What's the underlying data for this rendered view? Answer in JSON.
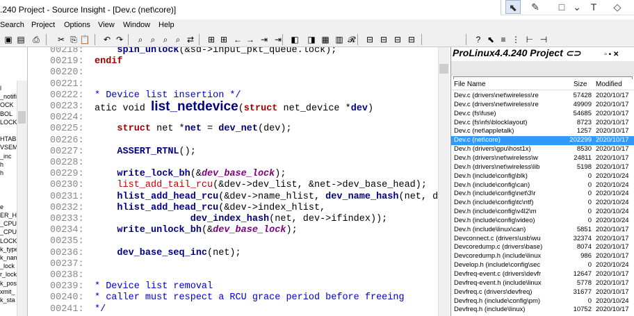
{
  "window": {
    "title": ".240 Project - Source Insight - [Dev.c (net\\core)]"
  },
  "annotation_tools": [
    {
      "name": "pointer-icon",
      "glyph": "⬉",
      "selected": true
    },
    {
      "name": "pen-icon",
      "glyph": "✎",
      "selected": false
    },
    {
      "name": "rectangle-icon",
      "glyph": "□",
      "selected": false
    },
    {
      "name": "dropdown-icon",
      "glyph": "⌄",
      "selected": false
    },
    {
      "name": "text-icon",
      "glyph": "T",
      "selected": false
    },
    {
      "name": "eraser-icon",
      "glyph": "◇",
      "selected": false
    }
  ],
  "menu": [
    "Search",
    "Project",
    "Options",
    "View",
    "Window",
    "Help"
  ],
  "left_symbols": [
    "l",
    "_notifi",
    "OCK",
    "BOL",
    "LOCK",
    "",
    "HTABI",
    "VSEM",
    "_inc",
    "h",
    "h",
    "",
    "",
    "",
    "e",
    "ER_HI",
    "_CPU_",
    "_CPU",
    "LOCK",
    "k_type",
    "k_nam",
    "_lock",
    "r_lock",
    "k_pos",
    "xmit_",
    "k_sta"
  ],
  "editor": {
    "lines": [
      {
        "n": "00218:",
        "parts": [
          {
            "c": "fn",
            "t": "    spin_unlock"
          },
          {
            "c": "pl",
            "t": "(&sd->input_pkt_queue.lock);"
          }
        ]
      },
      {
        "n": "00219:",
        "parts": [
          {
            "c": "kw",
            "t": "endif"
          }
        ]
      },
      {
        "n": "00220:",
        "parts": []
      },
      {
        "n": "00221:",
        "parts": []
      },
      {
        "n": "00222:",
        "parts": [
          {
            "c": "cm",
            "t": "* Device list insertion */"
          }
        ]
      },
      {
        "n": "00223:",
        "parts": [
          {
            "c": "pl",
            "t": "atic void "
          },
          {
            "c": "fnbig",
            "t": "list_netdevice"
          },
          {
            "c": "pl",
            "t": "("
          },
          {
            "c": "kw",
            "t": "struct"
          },
          {
            "c": "pl",
            "t": " net_device *"
          },
          {
            "c": "fn",
            "t": "dev"
          },
          {
            "c": "pl",
            "t": ")"
          }
        ]
      },
      {
        "n": "00224:",
        "parts": []
      },
      {
        "n": "00225:",
        "parts": [
          {
            "c": "kw",
            "t": "    struct"
          },
          {
            "c": "pl",
            "t": " net *"
          },
          {
            "c": "fn",
            "t": "net"
          },
          {
            "c": "pl",
            "t": " = "
          },
          {
            "c": "fn",
            "t": "dev_net"
          },
          {
            "c": "pl",
            "t": "(dev);"
          }
        ]
      },
      {
        "n": "00226:",
        "parts": []
      },
      {
        "n": "00227:",
        "parts": [
          {
            "c": "fn",
            "t": "    ASSERT_RTNL"
          },
          {
            "c": "pl",
            "t": "();"
          }
        ]
      },
      {
        "n": "00228:",
        "parts": []
      },
      {
        "n": "00229:",
        "parts": [
          {
            "c": "fn",
            "t": "    write_lock_bh"
          },
          {
            "c": "pl",
            "t": "(&"
          },
          {
            "c": "it",
            "t": "dev_base_lock"
          },
          {
            "c": "pl",
            "t": ");"
          }
        ]
      },
      {
        "n": "00230:",
        "parts": [
          {
            "c": "rd",
            "t": "    list_add_tail_rcu"
          },
          {
            "c": "pl",
            "t": "(&dev->dev_list, &net->dev_base_head);"
          }
        ]
      },
      {
        "n": "00231:",
        "parts": [
          {
            "c": "fn",
            "t": "    hlist_add_head_rcu"
          },
          {
            "c": "pl",
            "t": "(&dev->name_hlist, "
          },
          {
            "c": "fn",
            "t": "dev_name_hash"
          },
          {
            "c": "pl",
            "t": "(net, de"
          }
        ]
      },
      {
        "n": "00232:",
        "parts": [
          {
            "c": "fn",
            "t": "    hlist_add_head_rcu"
          },
          {
            "c": "pl",
            "t": "(&dev->index_hlist,"
          }
        ]
      },
      {
        "n": "00233:",
        "parts": [
          {
            "c": "fn",
            "t": "                 dev_index_hash"
          },
          {
            "c": "pl",
            "t": "(net, dev->ifindex));"
          }
        ]
      },
      {
        "n": "00234:",
        "parts": [
          {
            "c": "fn",
            "t": "    write_unlock_bh"
          },
          {
            "c": "pl",
            "t": "(&"
          },
          {
            "c": "it",
            "t": "dev_base_lock"
          },
          {
            "c": "pl",
            "t": ");"
          }
        ]
      },
      {
        "n": "00235:",
        "parts": []
      },
      {
        "n": "00236:",
        "parts": [
          {
            "c": "fn",
            "t": "    dev_base_seq_inc"
          },
          {
            "c": "pl",
            "t": "(net);"
          }
        ]
      },
      {
        "n": "00237:",
        "parts": []
      },
      {
        "n": "00238:",
        "parts": []
      },
      {
        "n": "00239:",
        "parts": [
          {
            "c": "cm",
            "t": "* Device list removal"
          }
        ]
      },
      {
        "n": "00240:",
        "parts": [
          {
            "c": "cm",
            "t": "* caller must respect a RCU grace period before freeing"
          }
        ]
      },
      {
        "n": "00241:",
        "parts": [
          {
            "c": "cm",
            "t": "*/"
          }
        ]
      }
    ]
  },
  "project": {
    "title": "ProLinux4.4.240 Project",
    "columns": {
      "name": "File Name",
      "size": "Size",
      "modified": "Modified"
    },
    "files": [
      {
        "name": "Dev.c (drivers\\net\\wireless\\re",
        "size": "57428",
        "mod": "2020/10/17"
      },
      {
        "name": "Dev.c (drivers\\net\\wireless\\re",
        "size": "49909",
        "mod": "2020/10/17"
      },
      {
        "name": "Dev.c (fs\\fuse)",
        "size": "54685",
        "mod": "2020/10/17"
      },
      {
        "name": "Dev.c (fs\\nfs\\blocklayout)",
        "size": "8723",
        "mod": "2020/10/17"
      },
      {
        "name": "Dev.c (net\\appletalk)",
        "size": "1257",
        "mod": "2020/10/17"
      },
      {
        "name": "Dev.c (net\\core)",
        "size": "202299",
        "mod": "2020/10/17",
        "selected": true
      },
      {
        "name": "Dev.h (drivers\\gpu\\host1x)",
        "size": "8530",
        "mod": "2020/10/17"
      },
      {
        "name": "Dev.h (drivers\\net\\wireless\\w",
        "size": "24811",
        "mod": "2020/10/17"
      },
      {
        "name": "Dev.h (drivers\\net\\wireless\\lib",
        "size": "5198",
        "mod": "2020/10/17"
      },
      {
        "name": "Dev.h (include\\config\\blk)",
        "size": "0",
        "mod": "2020/10/24"
      },
      {
        "name": "Dev.h (include\\config\\can)",
        "size": "0",
        "mod": "2020/10/24"
      },
      {
        "name": "Dev.h (include\\config\\net\\3\\r",
        "size": "0",
        "mod": "2020/10/24"
      },
      {
        "name": "Dev.h (include\\config\\tc\\ntf)",
        "size": "0",
        "mod": "2020/10/24"
      },
      {
        "name": "Dev.h (include\\config\\v4l2\\m",
        "size": "0",
        "mod": "2020/10/24"
      },
      {
        "name": "Dev.h (include\\config\\video)",
        "size": "0",
        "mod": "2020/10/24"
      },
      {
        "name": "Dev.h (include\\linux\\can)",
        "size": "5851",
        "mod": "2020/10/17"
      },
      {
        "name": "Devconnect.c (drivers\\usb\\wu",
        "size": "32374",
        "mod": "2020/10/17"
      },
      {
        "name": "Devcoredump.c (drivers\\base)",
        "size": "8074",
        "mod": "2020/10/17"
      },
      {
        "name": "Devcoredump.h (include\\linux",
        "size": "986",
        "mod": "2020/10/17"
      },
      {
        "name": "Develop.h (include\\config\\sec",
        "size": "0",
        "mod": "2020/10/24"
      },
      {
        "name": "Devfreq-event.c (drivers\\devfr",
        "size": "12647",
        "mod": "2020/10/17"
      },
      {
        "name": "Devfreq-event.h (include\\linux",
        "size": "5778",
        "mod": "2020/10/17"
      },
      {
        "name": "Devfreq.c (drivers\\devfreq)",
        "size": "31677",
        "mod": "2020/10/17"
      },
      {
        "name": "Devfreq.h (include\\config\\pm)",
        "size": "0",
        "mod": "2020/10/24"
      },
      {
        "name": "Devfreq.h (include\\linux)",
        "size": "10752",
        "mod": "2020/10/17"
      }
    ]
  }
}
